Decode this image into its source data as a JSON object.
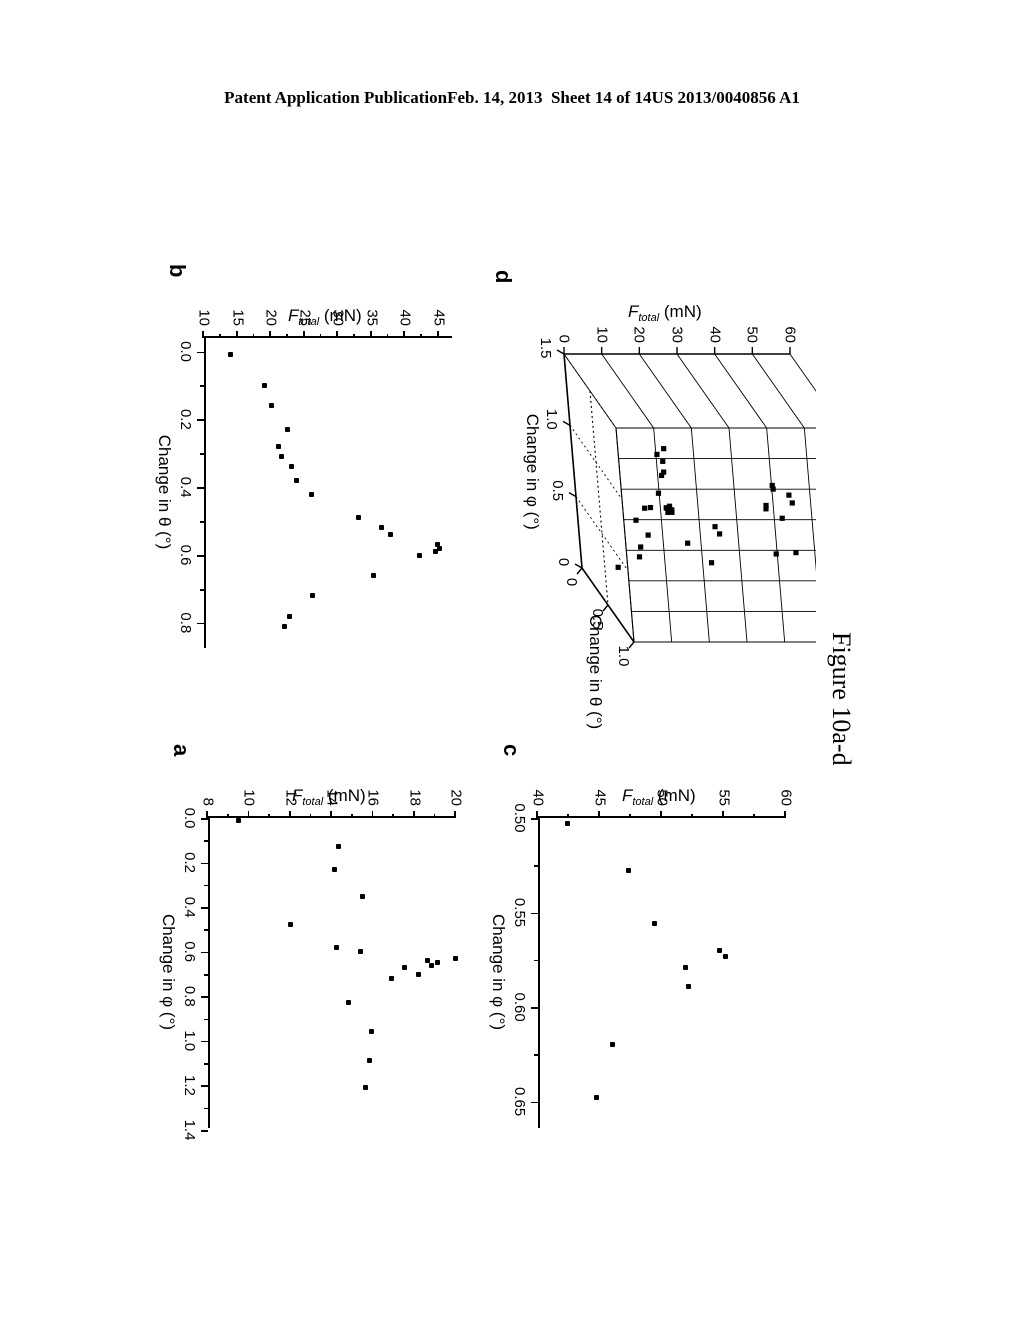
{
  "header": {
    "left": "Patent Application Publication",
    "date": "Feb. 14, 2013",
    "sheet": "Sheet 14 of 14",
    "patent_number": "US 2013/0040856 A1"
  },
  "caption": "Figure 10a-d",
  "colors": {
    "ink": "#000000",
    "paper": "#ffffff"
  },
  "panels": {
    "a": {
      "letter": "a",
      "xlabel_html": "Change in φ (°)",
      "ylabel_text": "F",
      "ylabel_sub": "total",
      "ylabel_unit": " (mN)",
      "xticks": [
        "0.0",
        "0.2",
        "0.4",
        "0.6",
        "0.8",
        "1.0",
        "1.2",
        "1.4"
      ],
      "yticks": [
        "8",
        "10",
        "12",
        "14",
        "16",
        "18",
        "20"
      ]
    },
    "b": {
      "letter": "b",
      "xlabel_html": "Change in θ (°)",
      "ylabel_text": "F",
      "ylabel_sub": "total",
      "ylabel_unit": " (mN)",
      "xticks": [
        "0.0",
        "0.2",
        "0.4",
        "0.6",
        "0.8"
      ],
      "yticks": [
        "10",
        "15",
        "20",
        "25",
        "30",
        "35",
        "40",
        "45"
      ]
    },
    "c": {
      "letter": "c",
      "xlabel_html": "Change in φ (°)",
      "ylabel_text": "F",
      "ylabel_sub": "total",
      "ylabel_unit": " (mN)",
      "xticks": [
        "0.50",
        "0.55",
        "0.60",
        "0.65"
      ],
      "yticks": [
        "40",
        "45",
        "50",
        "55",
        "60"
      ]
    },
    "d": {
      "letter": "d",
      "xlabel_html": "Change in φ (°)",
      "ylabel_html": "Change in θ (°)",
      "zlabel_text": "F",
      "zlabel_sub": "total",
      "zlabel_unit": " (mN)",
      "xticks": [
        "1.5",
        "1.0",
        "0.5",
        "0"
      ],
      "yticks": [
        "0",
        "0.5",
        "1.0"
      ],
      "zticks": [
        "0",
        "10",
        "20",
        "30",
        "40",
        "50",
        "60"
      ]
    }
  },
  "chart_data": [
    {
      "type": "scatter",
      "panel": "a",
      "title": "",
      "xlabel": "Change in φ (°)",
      "ylabel": "F_total (mN)",
      "xlim": [
        0.0,
        1.4
      ],
      "ylim": [
        8,
        20
      ],
      "xticks": [
        0.0,
        0.2,
        0.4,
        0.6,
        0.8,
        1.0,
        1.2,
        1.4
      ],
      "yticks": [
        8,
        10,
        12,
        14,
        16,
        18,
        20
      ],
      "grid": false,
      "legend": "none",
      "marker": "x",
      "points": [
        {
          "x": 0.01,
          "y": 9.5
        },
        {
          "x": 0.13,
          "y": 14.3
        },
        {
          "x": 0.23,
          "y": 14.1
        },
        {
          "x": 0.35,
          "y": 15.5
        },
        {
          "x": 0.48,
          "y": 12.0
        },
        {
          "x": 0.58,
          "y": 14.2
        },
        {
          "x": 0.6,
          "y": 15.4
        },
        {
          "x": 0.63,
          "y": 20.0
        },
        {
          "x": 0.64,
          "y": 18.6
        },
        {
          "x": 0.65,
          "y": 19.1
        },
        {
          "x": 0.66,
          "y": 18.8
        },
        {
          "x": 0.67,
          "y": 17.5
        },
        {
          "x": 0.7,
          "y": 18.2
        },
        {
          "x": 0.72,
          "y": 16.9
        },
        {
          "x": 0.83,
          "y": 14.8
        },
        {
          "x": 0.96,
          "y": 15.9
        },
        {
          "x": 1.09,
          "y": 15.8
        },
        {
          "x": 1.21,
          "y": 15.6
        }
      ]
    },
    {
      "type": "scatter",
      "panel": "b",
      "title": "",
      "xlabel": "Change in θ (°)",
      "ylabel": "F_total (mN)",
      "xlim": [
        -0.04,
        0.88
      ],
      "ylim": [
        10,
        47
      ],
      "xticks": [
        0.0,
        0.2,
        0.4,
        0.6,
        0.8
      ],
      "yticks": [
        10,
        15,
        20,
        25,
        30,
        35,
        40,
        45
      ],
      "grid": false,
      "legend": "none",
      "marker": "x",
      "points": [
        {
          "x": 0.01,
          "y": 14.0
        },
        {
          "x": 0.1,
          "y": 19.0
        },
        {
          "x": 0.16,
          "y": 20.0
        },
        {
          "x": 0.23,
          "y": 22.4
        },
        {
          "x": 0.28,
          "y": 21.1
        },
        {
          "x": 0.31,
          "y": 21.5
        },
        {
          "x": 0.34,
          "y": 23.0
        },
        {
          "x": 0.38,
          "y": 23.8
        },
        {
          "x": 0.42,
          "y": 26.0
        },
        {
          "x": 0.49,
          "y": 33.0
        },
        {
          "x": 0.52,
          "y": 36.5
        },
        {
          "x": 0.54,
          "y": 37.8
        },
        {
          "x": 0.57,
          "y": 44.8
        },
        {
          "x": 0.58,
          "y": 45.2
        },
        {
          "x": 0.59,
          "y": 44.5
        },
        {
          "x": 0.6,
          "y": 42.1
        },
        {
          "x": 0.66,
          "y": 35.3
        },
        {
          "x": 0.72,
          "y": 26.2
        },
        {
          "x": 0.78,
          "y": 22.8
        },
        {
          "x": 0.81,
          "y": 22.0
        }
      ]
    },
    {
      "type": "scatter",
      "panel": "c",
      "title": "",
      "xlabel": "Change in φ (°)",
      "ylabel": "F_total (mN)",
      "xlim": [
        0.5,
        0.665
      ],
      "ylim": [
        40,
        60
      ],
      "xticks": [
        0.5,
        0.55,
        0.6,
        0.65
      ],
      "yticks": [
        40,
        45,
        50,
        55,
        60
      ],
      "grid": false,
      "legend": "none",
      "marker": "x",
      "points": [
        {
          "x": 0.503,
          "y": 42.4
        },
        {
          "x": 0.528,
          "y": 47.3
        },
        {
          "x": 0.556,
          "y": 49.4
        },
        {
          "x": 0.57,
          "y": 54.6
        },
        {
          "x": 0.573,
          "y": 55.1
        },
        {
          "x": 0.579,
          "y": 51.9
        },
        {
          "x": 0.589,
          "y": 52.1
        },
        {
          "x": 0.62,
          "y": 46.0
        },
        {
          "x": 0.648,
          "y": 44.7
        }
      ]
    },
    {
      "type": "scatter3d",
      "panel": "d",
      "title": "",
      "xlabel": "Change in φ (°)",
      "ylabel": "Change in θ (°)",
      "zlabel": "F_total (mN)",
      "xlim": [
        1.5,
        0.0
      ],
      "ylim": [
        0.0,
        1.0
      ],
      "zlim": [
        0,
        60
      ],
      "xticks": [
        1.5,
        1.0,
        0.5,
        0
      ],
      "yticks": [
        0,
        0.5,
        1.0
      ],
      "zticks": [
        0,
        10,
        20,
        30,
        40,
        50,
        60
      ],
      "grid": true,
      "legend": "none",
      "marker": "x",
      "points": [
        {
          "x": 0.01,
          "y": 0.01,
          "z": 9.5
        },
        {
          "x": 0.13,
          "y": 0.1,
          "z": 14.3
        },
        {
          "x": 0.23,
          "y": 0.16,
          "z": 14.1
        },
        {
          "x": 0.35,
          "y": 0.23,
          "z": 15.5
        },
        {
          "x": 0.48,
          "y": 0.28,
          "z": 12.0
        },
        {
          "x": 0.58,
          "y": 0.31,
          "z": 14.2
        },
        {
          "x": 0.6,
          "y": 0.34,
          "z": 15.4
        },
        {
          "x": 0.63,
          "y": 0.38,
          "z": 20.0
        },
        {
          "x": 0.64,
          "y": 0.42,
          "z": 18.6
        },
        {
          "x": 0.65,
          "y": 0.49,
          "z": 19.1
        },
        {
          "x": 0.66,
          "y": 0.52,
          "z": 18.8
        },
        {
          "x": 0.67,
          "y": 0.54,
          "z": 17.5
        },
        {
          "x": 0.7,
          "y": 0.57,
          "z": 18.2
        },
        {
          "x": 0.72,
          "y": 0.58,
          "z": 16.9
        },
        {
          "x": 0.83,
          "y": 0.59,
          "z": 14.8
        },
        {
          "x": 0.96,
          "y": 0.6,
          "z": 15.9
        },
        {
          "x": 1.09,
          "y": 0.66,
          "z": 15.8
        },
        {
          "x": 1.21,
          "y": 0.72,
          "z": 15.6
        },
        {
          "x": 0.503,
          "y": 0.78,
          "z": 42.4
        },
        {
          "x": 0.528,
          "y": 0.81,
          "z": 47.3
        },
        {
          "x": 0.556,
          "y": 0.4,
          "z": 49.4
        },
        {
          "x": 0.57,
          "y": 0.22,
          "z": 54.6
        },
        {
          "x": 0.573,
          "y": 0.12,
          "z": 55.1
        },
        {
          "x": 0.579,
          "y": 0.05,
          "z": 51.9
        },
        {
          "x": 0.589,
          "y": 0.02,
          "z": 52.1
        },
        {
          "x": 0.62,
          "y": 0.35,
          "z": 46.0
        },
        {
          "x": 0.648,
          "y": 0.45,
          "z": 44.7
        },
        {
          "x": 0.3,
          "y": 0.02,
          "z": 36.0
        },
        {
          "x": 0.2,
          "y": 0.05,
          "z": 28.0
        },
        {
          "x": 0.45,
          "y": 0.08,
          "z": 24.0
        },
        {
          "x": 0.75,
          "y": 0.15,
          "z": 22.0
        },
        {
          "x": 0.9,
          "y": 0.2,
          "z": 20.0
        },
        {
          "x": 0.55,
          "y": 0.6,
          "z": 30.0
        },
        {
          "x": 0.4,
          "y": 0.7,
          "z": 26.0
        }
      ]
    }
  ]
}
